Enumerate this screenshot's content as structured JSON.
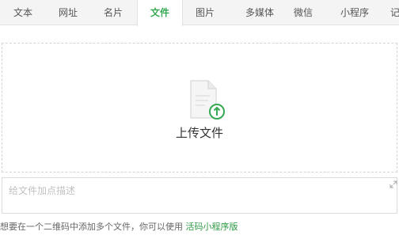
{
  "tabs": [
    {
      "label": "文本"
    },
    {
      "label": "网址"
    },
    {
      "label": "名片"
    },
    {
      "label": "文件",
      "active": true
    },
    {
      "label": "图片"
    },
    {
      "label": "多媒体"
    },
    {
      "label": "微信"
    },
    {
      "label": "小程序"
    },
    {
      "label": "记"
    }
  ],
  "upload": {
    "label": "上传文件",
    "icon": "file-upload-icon"
  },
  "description": {
    "placeholder": "给文件加点描述",
    "value": ""
  },
  "tip": {
    "text": "想要在一个二维码中添加多个文件，你可以使用 ",
    "link": "活码小程序版"
  },
  "colors": {
    "accent": "#35a853",
    "tab_bar": "#f4f4f4",
    "link": "#2f9a46"
  }
}
